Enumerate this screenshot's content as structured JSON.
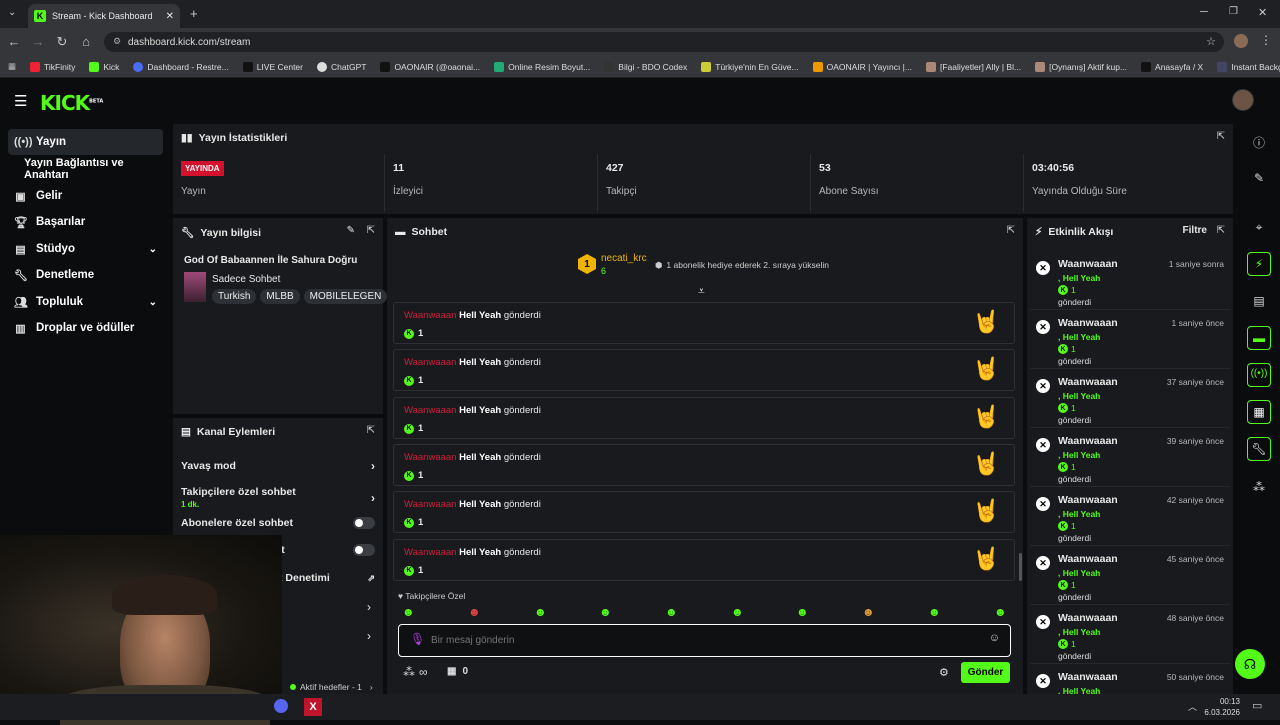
{
  "browser": {
    "tab_title": "Stream - Kick Dashboard",
    "url": "dashboard.kick.com/stream",
    "bookmarks": [
      "TikFinity",
      "Kick",
      "Dashboard - Restre...",
      "LIVE Center",
      "ChatGPT",
      "OAONAIR (@oaonai...",
      "Online Resim Boyut...",
      "Bilgi - BDO Codex",
      "Türkiye'nin En Güve...",
      "OAONAIR | Yayıncı |...",
      "[Faaliyetler] Ally | Bl...",
      "[Oynanış] Aktif kup...",
      "Anasayfa / X",
      "Instant Background..."
    ]
  },
  "header": {
    "logo": "KICK",
    "logo_sup": "BETA"
  },
  "sidebar": {
    "items": [
      {
        "label": "Yayın",
        "icon": "broadcast-icon"
      },
      {
        "label": "Yayın Bağlantısı ve Anahtarı",
        "icon": ""
      },
      {
        "label": "Gelir",
        "icon": "wallet-icon"
      },
      {
        "label": "Başarılar",
        "icon": "trophy-icon"
      },
      {
        "label": "Stüdyo",
        "icon": "studio-icon"
      },
      {
        "label": "Denetleme",
        "icon": "wrench-icon"
      },
      {
        "label": "Topluluk",
        "icon": "people-icon"
      },
      {
        "label": "Droplar ve ödüller",
        "icon": "gift-icon"
      }
    ]
  },
  "stats": {
    "title": "Yayın İstatistikleri",
    "live_badge": "YAYINDA",
    "items": [
      {
        "value": "",
        "label": "Yayın"
      },
      {
        "value": "11",
        "label": "İzleyici"
      },
      {
        "value": "427",
        "label": "Takipçi"
      },
      {
        "value": "53",
        "label": "Abone Sayısı"
      },
      {
        "value": "03:40:56",
        "label": "Yayında Olduğu Süre"
      }
    ]
  },
  "stream_info": {
    "title": "Yayın bilgisi",
    "stream_title": "God Of Babaannen İle Sahura Doğru",
    "category": "Sadece Sohbet",
    "tags": [
      "Turkish",
      "MLBB",
      "MOBILELEGEN"
    ]
  },
  "channel_actions": {
    "title": "Kanal Eylemleri",
    "rows": [
      {
        "label": "Yavaş mod",
        "sub": ""
      },
      {
        "label": "Takipçilere özel sohbet",
        "sub": "1 dk."
      },
      {
        "label": "Abonelere özel sohbet",
        "sub": ""
      },
      {
        "label": "bet",
        "sub": ""
      },
      {
        "label": "t Denetimi",
        "sub": ""
      }
    ],
    "goals": "Aktif hedefler - 1"
  },
  "chat": {
    "title": "Sohbet",
    "pinned_user": "necati_krc",
    "pinned_count": "6",
    "pinned_rank": "1",
    "pinned_text": "1 abonelik hediye ederek 2. sıraya yükselin",
    "messages": [
      {
        "user": "Waanwaaan",
        "item": "Hell Yeah",
        "verb": "gönderdi",
        "count": "1"
      },
      {
        "user": "Waanwaaan",
        "item": "Hell Yeah",
        "verb": "gönderdi",
        "count": "1"
      },
      {
        "user": "Waanwaaan",
        "item": "Hell Yeah",
        "verb": "gönderdi",
        "count": "1"
      },
      {
        "user": "Waanwaaan",
        "item": "Hell Yeah",
        "verb": "gönderdi",
        "count": "1"
      },
      {
        "user": "Waanwaaan",
        "item": "Hell Yeah",
        "verb": "gönderdi",
        "count": "1"
      },
      {
        "user": "Waanwaaan",
        "item": "Hell Yeah",
        "verb": "gönderdi",
        "count": "1"
      }
    ],
    "followers_only": "Takipçilere Özel",
    "input_placeholder": "Bir mesaj gönderin",
    "infinity": "∞",
    "gift_count": "0",
    "send_label": "Gönder"
  },
  "events": {
    "title": "Etkinlik Akışı",
    "filter": "Filtre",
    "items": [
      {
        "user": "Waanwaaan",
        "time": "1 saniye sonra",
        "item": ", Hell Yeah",
        "count": "1",
        "verb": "gönderdi"
      },
      {
        "user": "Waanwaaan",
        "time": "1 saniye önce",
        "item": ", Hell Yeah",
        "count": "1",
        "verb": "gönderdi"
      },
      {
        "user": "Waanwaaan",
        "time": "37 saniye önce",
        "item": ", Hell Yeah",
        "count": "1",
        "verb": "gönderdi"
      },
      {
        "user": "Waanwaaan",
        "time": "39 saniye önce",
        "item": ", Hell Yeah",
        "count": "1",
        "verb": "gönderdi"
      },
      {
        "user": "Waanwaaan",
        "time": "42 saniye önce",
        "item": ", Hell Yeah",
        "count": "1",
        "verb": "gönderdi"
      },
      {
        "user": "Waanwaaan",
        "time": "45 saniye önce",
        "item": ", Hell Yeah",
        "count": "1",
        "verb": "gönderdi"
      },
      {
        "user": "Waanwaaan",
        "time": "48 saniye önce",
        "item": ", Hell Yeah",
        "count": "1",
        "verb": "gönderdi"
      },
      {
        "user": "Waanwaaan",
        "time": "50 saniye önce",
        "item": ", Hell Yeah",
        "count": "1",
        "verb": "gönderdi"
      }
    ]
  },
  "taskbar": {
    "time": "00:13",
    "date": "6.03.2026"
  },
  "colors": {
    "accent": "#53fc18",
    "live": "#d3112d",
    "username": "#d61e3a",
    "panel": "#181a1d"
  }
}
